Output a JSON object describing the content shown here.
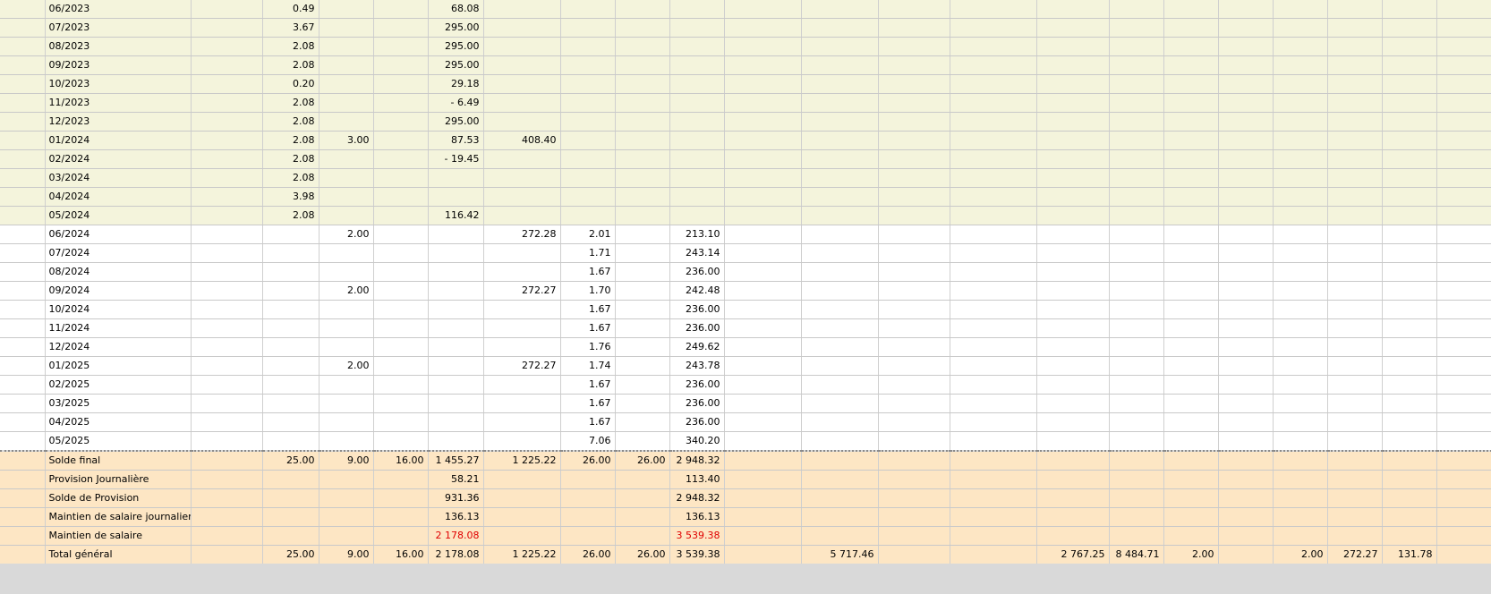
{
  "rows": [
    {
      "tone": "y",
      "cells": [
        "",
        "06/2023",
        "",
        "0.49",
        "",
        "",
        "68.08",
        "",
        "",
        "",
        "",
        "",
        "",
        "",
        "",
        "",
        "",
        "",
        "",
        "",
        "",
        "",
        ""
      ]
    },
    {
      "tone": "y",
      "cells": [
        "",
        "07/2023",
        "",
        "3.67",
        "",
        "",
        "295.00",
        "",
        "",
        "",
        "",
        "",
        "",
        "",
        "",
        "",
        "",
        "",
        "",
        "",
        "",
        "",
        ""
      ]
    },
    {
      "tone": "y",
      "cells": [
        "",
        "08/2023",
        "",
        "2.08",
        "",
        "",
        "295.00",
        "",
        "",
        "",
        "",
        "",
        "",
        "",
        "",
        "",
        "",
        "",
        "",
        "",
        "",
        "",
        ""
      ]
    },
    {
      "tone": "y",
      "cells": [
        "",
        "09/2023",
        "",
        "2.08",
        "",
        "",
        "295.00",
        "",
        "",
        "",
        "",
        "",
        "",
        "",
        "",
        "",
        "",
        "",
        "",
        "",
        "",
        "",
        ""
      ]
    },
    {
      "tone": "y",
      "cells": [
        "",
        "10/2023",
        "",
        "0.20",
        "",
        "",
        "29.18",
        "",
        "",
        "",
        "",
        "",
        "",
        "",
        "",
        "",
        "",
        "",
        "",
        "",
        "",
        "",
        ""
      ]
    },
    {
      "tone": "y",
      "cells": [
        "",
        "11/2023",
        "",
        "2.08",
        "",
        "",
        "- 6.49",
        "",
        "",
        "",
        "",
        "",
        "",
        "",
        "",
        "",
        "",
        "",
        "",
        "",
        "",
        "",
        ""
      ]
    },
    {
      "tone": "y",
      "cells": [
        "",
        "12/2023",
        "",
        "2.08",
        "",
        "",
        "295.00",
        "",
        "",
        "",
        "",
        "",
        "",
        "",
        "",
        "",
        "",
        "",
        "",
        "",
        "",
        "",
        ""
      ]
    },
    {
      "tone": "y",
      "cells": [
        "",
        "01/2024",
        "",
        "2.08",
        "3.00",
        "",
        "87.53",
        "408.40",
        "",
        "",
        "",
        "",
        "",
        "",
        "",
        "",
        "",
        "",
        "",
        "",
        "",
        "",
        ""
      ]
    },
    {
      "tone": "y",
      "cells": [
        "",
        "02/2024",
        "",
        "2.08",
        "",
        "",
        "- 19.45",
        "",
        "",
        "",
        "",
        "",
        "",
        "",
        "",
        "",
        "",
        "",
        "",
        "",
        "",
        "",
        ""
      ]
    },
    {
      "tone": "y",
      "cells": [
        "",
        "03/2024",
        "",
        "2.08",
        "",
        "",
        "",
        "",
        "",
        "",
        "",
        "",
        "",
        "",
        "",
        "",
        "",
        "",
        "",
        "",
        "",
        "",
        ""
      ]
    },
    {
      "tone": "y",
      "cells": [
        "",
        "04/2024",
        "",
        "3.98",
        "",
        "",
        "",
        "",
        "",
        "",
        "",
        "",
        "",
        "",
        "",
        "",
        "",
        "",
        "",
        "",
        "",
        "",
        ""
      ]
    },
    {
      "tone": "y",
      "cells": [
        "",
        "05/2024",
        "",
        "2.08",
        "",
        "",
        "116.42",
        "",
        "",
        "",
        "",
        "",
        "",
        "",
        "",
        "",
        "",
        "",
        "",
        "",
        "",
        "",
        ""
      ]
    },
    {
      "tone": "w",
      "cells": [
        "",
        "06/2024",
        "",
        "",
        "2.00",
        "",
        "",
        "272.28",
        "2.01",
        "",
        "213.10",
        "",
        "",
        "",
        "",
        "",
        "",
        "",
        "",
        "",
        "",
        "",
        ""
      ]
    },
    {
      "tone": "w",
      "cells": [
        "",
        "07/2024",
        "",
        "",
        "",
        "",
        "",
        "",
        "1.71",
        "",
        "243.14",
        "",
        "",
        "",
        "",
        "",
        "",
        "",
        "",
        "",
        "",
        "",
        ""
      ]
    },
    {
      "tone": "w",
      "cells": [
        "",
        "08/2024",
        "",
        "",
        "",
        "",
        "",
        "",
        "1.67",
        "",
        "236.00",
        "",
        "",
        "",
        "",
        "",
        "",
        "",
        "",
        "",
        "",
        "",
        ""
      ]
    },
    {
      "tone": "w",
      "cells": [
        "",
        "09/2024",
        "",
        "",
        "2.00",
        "",
        "",
        "272.27",
        "1.70",
        "",
        "242.48",
        "",
        "",
        "",
        "",
        "",
        "",
        "",
        "",
        "",
        "",
        "",
        ""
      ]
    },
    {
      "tone": "w",
      "cells": [
        "",
        "10/2024",
        "",
        "",
        "",
        "",
        "",
        "",
        "1.67",
        "",
        "236.00",
        "",
        "",
        "",
        "",
        "",
        "",
        "",
        "",
        "",
        "",
        "",
        ""
      ]
    },
    {
      "tone": "w",
      "cells": [
        "",
        "11/2024",
        "",
        "",
        "",
        "",
        "",
        "",
        "1.67",
        "",
        "236.00",
        "",
        "",
        "",
        "",
        "",
        "",
        "",
        "",
        "",
        "",
        "",
        ""
      ]
    },
    {
      "tone": "w",
      "cells": [
        "",
        "12/2024",
        "",
        "",
        "",
        "",
        "",
        "",
        "1.76",
        "",
        "249.62",
        "",
        "",
        "",
        "",
        "",
        "",
        "",
        "",
        "",
        "",
        "",
        ""
      ]
    },
    {
      "tone": "w",
      "cells": [
        "",
        "01/2025",
        "",
        "",
        "2.00",
        "",
        "",
        "272.27",
        "1.74",
        "",
        "243.78",
        "",
        "",
        "",
        "",
        "",
        "",
        "",
        "",
        "",
        "",
        "",
        ""
      ]
    },
    {
      "tone": "w",
      "cells": [
        "",
        "02/2025",
        "",
        "",
        "",
        "",
        "",
        "",
        "1.67",
        "",
        "236.00",
        "",
        "",
        "",
        "",
        "",
        "",
        "",
        "",
        "",
        "",
        "",
        ""
      ]
    },
    {
      "tone": "w",
      "cells": [
        "",
        "03/2025",
        "",
        "",
        "",
        "",
        "",
        "",
        "1.67",
        "",
        "236.00",
        "",
        "",
        "",
        "",
        "",
        "",
        "",
        "",
        "",
        "",
        "",
        ""
      ]
    },
    {
      "tone": "w",
      "cells": [
        "",
        "04/2025",
        "",
        "",
        "",
        "",
        "",
        "",
        "1.67",
        "",
        "236.00",
        "",
        "",
        "",
        "",
        "",
        "",
        "",
        "",
        "",
        "",
        "",
        ""
      ]
    },
    {
      "tone": "w",
      "dash": true,
      "cells": [
        "",
        "05/2025",
        "",
        "",
        "",
        "",
        "",
        "",
        "7.06",
        "",
        "340.20",
        "",
        "",
        "",
        "",
        "",
        "",
        "",
        "",
        "",
        "",
        "",
        ""
      ]
    },
    {
      "tone": "o",
      "cells": [
        "",
        "Solde final",
        "",
        "25.00",
        "9.00",
        "16.00",
        "1 455.27",
        "1 225.22",
        "26.00",
        "26.00",
        "2 948.32",
        "",
        "",
        "",
        "",
        "",
        "",
        "",
        "",
        "",
        "",
        "",
        ""
      ]
    },
    {
      "tone": "o",
      "cells": [
        "",
        "Provision Journalière",
        "",
        "",
        "",
        "",
        "58.21",
        "",
        "",
        "",
        "113.40",
        "",
        "",
        "",
        "",
        "",
        "",
        "",
        "",
        "",
        "",
        "",
        ""
      ]
    },
    {
      "tone": "o",
      "cells": [
        "",
        "Solde de Provision",
        "",
        "",
        "",
        "",
        "931.36",
        "",
        "",
        "",
        "2 948.32",
        "",
        "",
        "",
        "",
        "",
        "",
        "",
        "",
        "",
        "",
        "",
        ""
      ]
    },
    {
      "tone": "o",
      "cells": [
        "",
        "Maintien de salaire journalier",
        "",
        "",
        "",
        "",
        "136.13",
        "",
        "",
        "",
        "136.13",
        "",
        "",
        "",
        "",
        "",
        "",
        "",
        "",
        "",
        "",
        "",
        ""
      ]
    },
    {
      "tone": "o",
      "red": [
        6,
        10
      ],
      "cells": [
        "",
        "Maintien de salaire",
        "",
        "",
        "",
        "",
        "2 178.08",
        "",
        "",
        "",
        "3 539.38",
        "",
        "",
        "",
        "",
        "",
        "",
        "",
        "",
        "",
        "",
        "",
        ""
      ]
    },
    {
      "tone": "o",
      "cells": [
        "",
        "Total général",
        "",
        "25.00",
        "9.00",
        "16.00",
        "2 178.08",
        "1 225.22",
        "26.00",
        "26.00",
        "3 539.38",
        "",
        "5 717.46",
        "",
        "",
        "2 767.25",
        "8 484.71",
        "2.00",
        "",
        "2.00",
        "272.27",
        "131.78",
        ""
      ]
    }
  ]
}
